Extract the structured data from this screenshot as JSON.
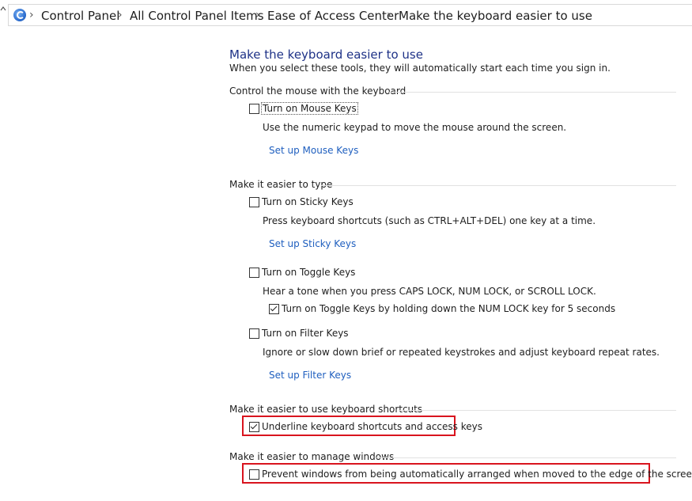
{
  "breadcrumb": {
    "items": [
      "Control Panel",
      "All Control Panel Items",
      "Ease of Access Center",
      "Make the keyboard easier to use"
    ],
    "separator": "›"
  },
  "page": {
    "title": "Make the keyboard easier to use",
    "subtitle": "When you select these tools, they will automatically start each time you sign in."
  },
  "sections": {
    "mouse": {
      "header": "Control the mouse with the keyboard",
      "mouse_keys": {
        "label": "Turn on Mouse Keys",
        "checked": false,
        "description": "Use the numeric keypad to move the mouse around the screen.",
        "link": "Set up Mouse Keys"
      }
    },
    "typing": {
      "header": "Make it easier to type",
      "sticky_keys": {
        "label": "Turn on Sticky Keys",
        "checked": false,
        "description": "Press keyboard shortcuts (such as CTRL+ALT+DEL) one key at a time.",
        "link": "Set up Sticky Keys"
      },
      "toggle_keys": {
        "label": "Turn on Toggle Keys",
        "checked": false,
        "description": "Hear a tone when you press CAPS LOCK, NUM LOCK, or SCROLL LOCK.",
        "sub_option": {
          "label": "Turn on Toggle Keys by holding down the NUM LOCK key for 5 seconds",
          "checked": true
        }
      },
      "filter_keys": {
        "label": "Turn on Filter Keys",
        "checked": false,
        "description": "Ignore or slow down brief or repeated keystrokes and adjust keyboard repeat rates.",
        "link": "Set up Filter Keys"
      }
    },
    "shortcuts": {
      "header": "Make it easier to use keyboard shortcuts",
      "underline": {
        "label": "Underline keyboard shortcuts and access keys",
        "checked": true
      }
    },
    "windows": {
      "header": "Make it easier to manage windows",
      "prevent_arrange": {
        "label": "Prevent windows from being automatically arranged when moved to the edge of the screen",
        "checked": false
      }
    }
  },
  "colors": {
    "title": "#1e3287",
    "link": "#1f5fbf",
    "highlight_box": "#d9141e"
  }
}
